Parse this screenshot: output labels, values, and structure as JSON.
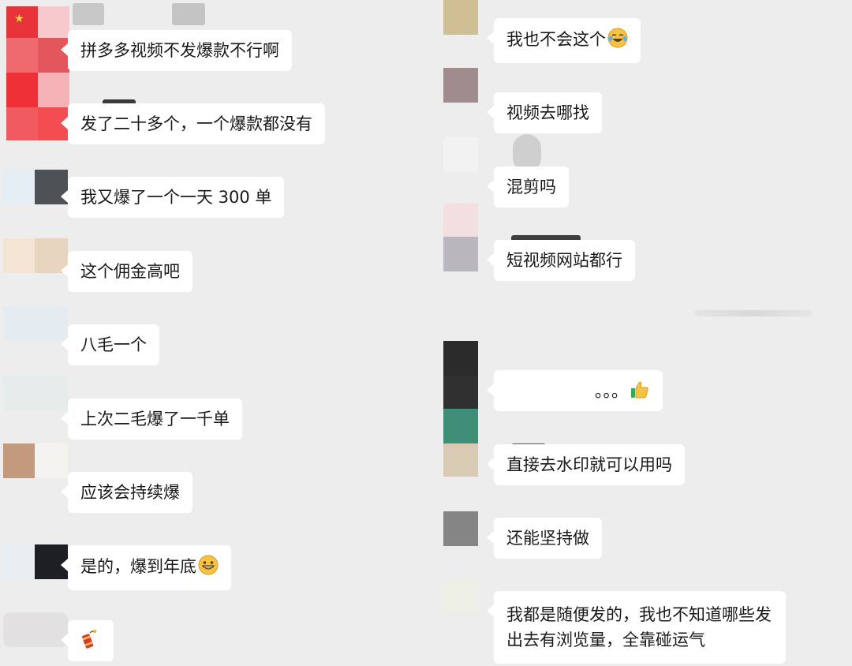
{
  "left_messages": [
    {
      "text": "拼多多视频不发爆款不行啊"
    },
    {
      "text": "发了二十多个，一个爆款都没有"
    },
    {
      "text": "我又爆了一个一天 300 单"
    },
    {
      "text": "这个佣金高吧"
    },
    {
      "text": "八毛一个"
    },
    {
      "text": "上次二毛爆了一千单"
    },
    {
      "text": "应该会持续爆"
    },
    {
      "text": "是的，爆到年底",
      "emoji": "grinning-face-icon"
    },
    {
      "text": "",
      "emoji": "firecracker-icon"
    }
  ],
  "right_messages": [
    {
      "text": "我也不会这个",
      "emoji": "tears-of-joy-face-icon"
    },
    {
      "text": "视频去哪找"
    },
    {
      "text": "混剪吗"
    },
    {
      "text": "短视频网站都行"
    },
    {
      "text": "。。。",
      "emoji": "thumbs-up-icon"
    },
    {
      "text": "直接去水印就可以用吗"
    },
    {
      "text": "还能坚持做"
    },
    {
      "text": "我都是随便发的，我也不知道哪些发出去有浏览量，全靠碰运气"
    }
  ],
  "colors": {
    "background": "#ededed",
    "bubble": "#ffffff",
    "text": "#191919"
  }
}
